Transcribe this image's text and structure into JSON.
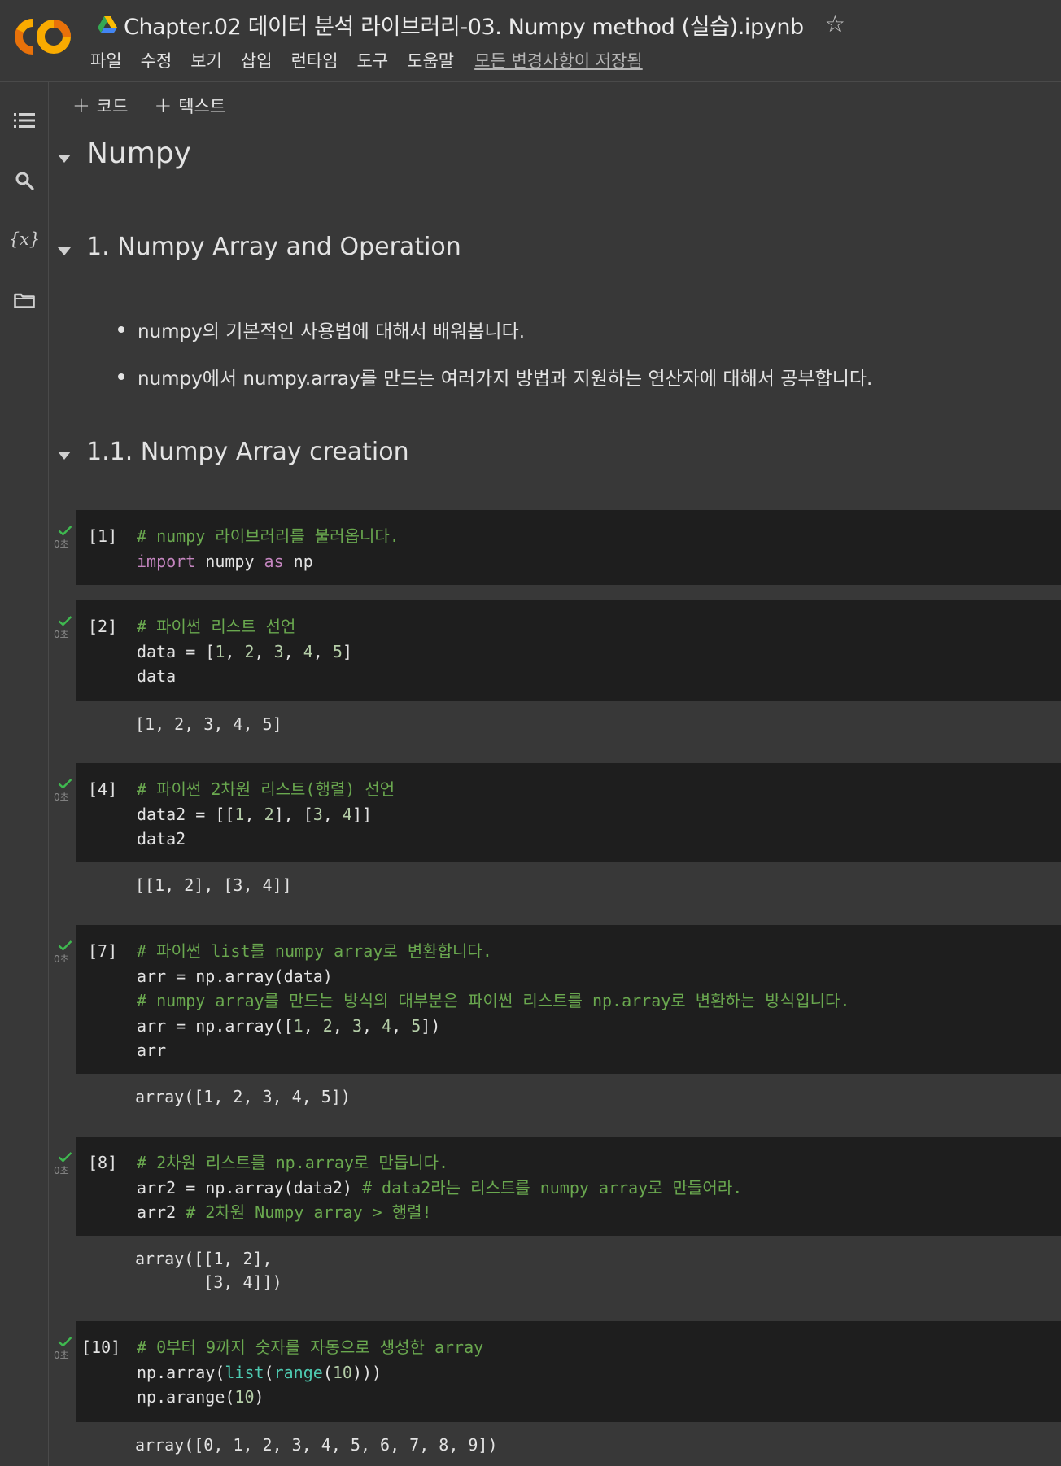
{
  "app": {
    "notebook_title": "Chapter.02 데이터 분석 라이브러리-03. Numpy method (실습).ipynb",
    "menu": [
      "파일",
      "수정",
      "보기",
      "삽입",
      "런타임",
      "도구",
      "도움말"
    ],
    "save_status": "모든 변경사항이 저장됨",
    "brand_colors": {
      "logo_orange": "#f9ab00",
      "logo_dark_orange": "#e8710a"
    }
  },
  "toolbar": {
    "add_code": "코드",
    "add_text": "텍스트"
  },
  "sidebar": {
    "icons": [
      "table-of-contents-icon",
      "search-icon",
      "variables-icon",
      "files-icon"
    ],
    "variables_glyph": "{x}"
  },
  "notebook": {
    "h_numpy": "Numpy",
    "h_section1": "1. Numpy Array and Operation",
    "bullets": [
      "numpy의 기본적인 사용법에 대해서 배워봅니다.",
      "numpy에서 numpy.array를 만드는 여러가지 방법과 지원하는 연산자에 대해서 공부합니다."
    ],
    "h_section11": "1.1. Numpy Array creation",
    "cells": [
      {
        "exec": "[1]",
        "duration": "0초",
        "output": ""
      },
      {
        "exec": "[2]",
        "duration": "0초",
        "output": "[1, 2, 3, 4, 5]"
      },
      {
        "exec": "[4]",
        "duration": "0초",
        "output": "[[1, 2], [3, 4]]"
      },
      {
        "exec": "[7]",
        "duration": "0초",
        "output": "array([1, 2, 3, 4, 5])"
      },
      {
        "exec": "[8]",
        "duration": "0초",
        "output": "array([[1, 2],\n       [3, 4]])"
      },
      {
        "exec": "[10]",
        "duration": "0초",
        "output": "array([0, 1, 2, 3, 4, 5, 6, 7, 8, 9])"
      }
    ],
    "code": {
      "c1_l1": "# numpy 라이브러리를 불러옵니다.",
      "c1_kw_import": "import",
      "c1_mod": " numpy ",
      "c1_kw_as": "as",
      "c1_alias": " np",
      "c2_l1": "# 파이썬 리스트 선언",
      "c2_l2a": "data = [",
      "c2_n1": "1",
      "c2_n2": "2",
      "c2_n3": "3",
      "c2_n4": "4",
      "c2_n5": "5",
      "c2_sep": ", ",
      "c2_close": "]",
      "c2_l3": "data",
      "c4_l1": "# 파이썬 2차원 리스트(행렬) 선언",
      "c4_l2a": "data2 = [[",
      "c4_n1": "1",
      "c4_n2": "2",
      "c4_n3": "3",
      "c4_n4": "4",
      "c4_mid": "], [",
      "c4_close": "]]",
      "c4_sep": ", ",
      "c4_l3": "data2",
      "c7_l1": "# 파이썬 list를 numpy array로 변환합니다.",
      "c7_l2": "arr = np.array(data)",
      "c7_l3": "# numpy array를 만드는 방식의 대부분은 파이썬 리스트를 np.array로 변환하는 방식입니다.",
      "c7_l4a": "arr = np.array([",
      "c7_n1": "1",
      "c7_n2": "2",
      "c7_n3": "3",
      "c7_n4": "4",
      "c7_n5": "5",
      "c7_sep": ", ",
      "c7_close": "])",
      "c7_l5": "arr",
      "c8_l1": "# 2차원 리스트를 np.array로 만듭니다.",
      "c8_l2a": "arr2 = np.array(data2) ",
      "c8_l2c": "# data2라는 리스트를 numpy array로 만들어라.",
      "c8_l3a": "arr2 ",
      "c8_l3c": "# 2차원 Numpy array > 행렬!",
      "c10_l1": "# 0부터 9까지 숫자를 자동으로 생성한 array",
      "c10_l2a": "np.array(",
      "c10_fn_list": "list",
      "c10_paren": "(",
      "c10_fn_range": "range",
      "c10_paren2": "(",
      "c10_n10": "10",
      "c10_close": ")))",
      "c10_l3a": "np.arange(",
      "c10_n10b": "10",
      "c10_l3b": ")"
    }
  }
}
